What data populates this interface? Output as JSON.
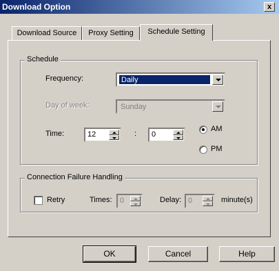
{
  "window": {
    "title": "Download Option",
    "close_glyph": "x"
  },
  "tabs": [
    "Download Source",
    "Proxy Setting",
    "Schedule Setting"
  ],
  "schedule": {
    "legend": "Schedule",
    "frequency_label": "Frequency:",
    "frequency_value": "Daily",
    "day_label": "Day of week:",
    "day_value": "Sunday",
    "time_label": "Time:",
    "hour": "12",
    "colon": ":",
    "minute": "0",
    "am_label": "AM",
    "pm_label": "PM",
    "am_selected": true
  },
  "failure": {
    "legend": "Connection Failure Handling",
    "retry_label": "Retry",
    "retry_checked": false,
    "times_label": "Times:",
    "times_value": "0",
    "delay_label": "Delay:",
    "delay_value": "0",
    "unit_label": "minute(s)"
  },
  "buttons": {
    "ok": "OK",
    "cancel": "Cancel",
    "help": "Help"
  }
}
